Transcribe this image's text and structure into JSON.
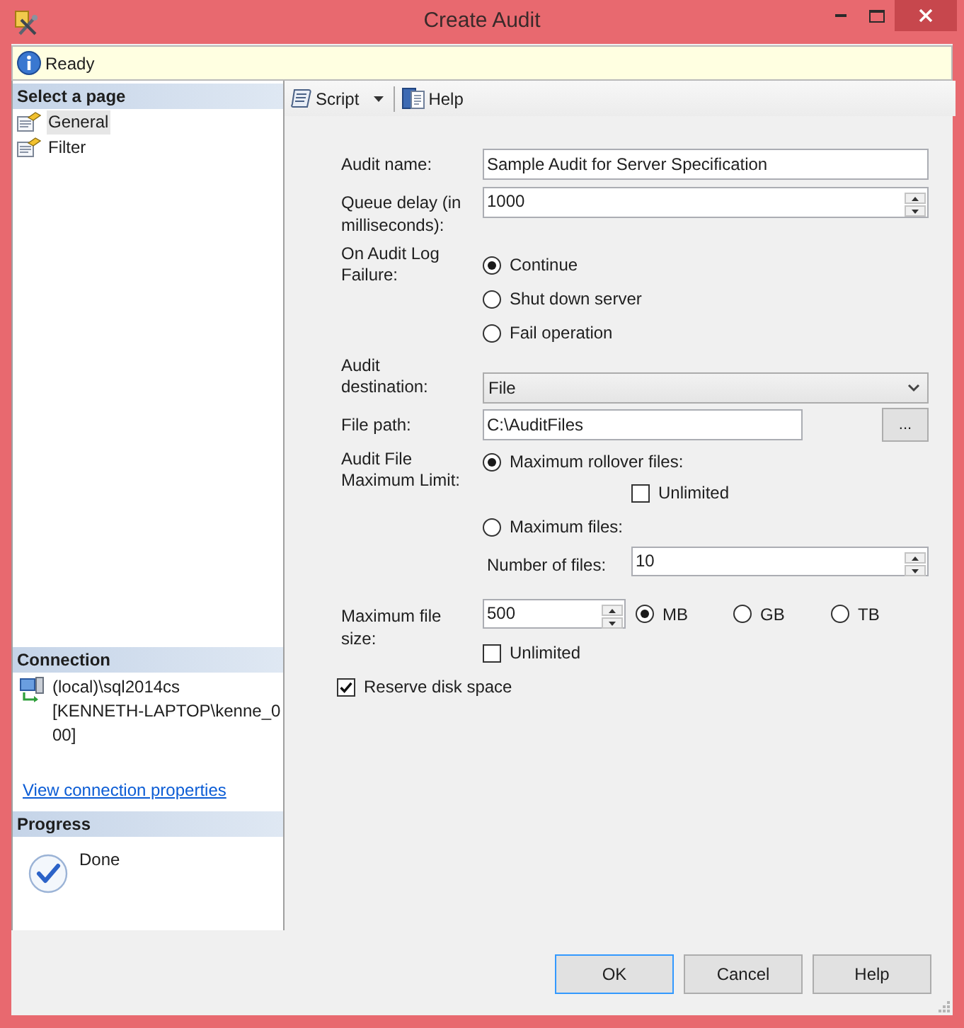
{
  "window": {
    "title": "Create Audit"
  },
  "status_bar": {
    "text": "Ready"
  },
  "sidebar": {
    "header": "Select a page",
    "items": [
      {
        "label": "General",
        "selected": true
      },
      {
        "label": "Filter",
        "selected": false
      }
    ]
  },
  "connection": {
    "header": "Connection",
    "server": "(local)\\sql2014cs",
    "login": "[KENNETH-LAPTOP\\kenne_000]",
    "link": "View connection properties"
  },
  "progress": {
    "header": "Progress",
    "status": "Done"
  },
  "toolbar": [
    {
      "kind": "dropdown",
      "label": "Script"
    },
    {
      "kind": "button",
      "label": "Help"
    }
  ],
  "form": {
    "audit_name": {
      "label": "Audit name:",
      "value": "Sample Audit for Server Specification"
    },
    "queue_delay": {
      "label": "Queue delay (in milliseconds):",
      "value": "1000"
    },
    "on_failure": {
      "label": "On Audit Log Failure:",
      "options": [
        {
          "label": "Continue",
          "selected": true
        },
        {
          "label": "Shut down server",
          "selected": false
        },
        {
          "label": "Fail operation",
          "selected": false
        }
      ]
    },
    "destination": {
      "label": "Audit destination:",
      "value": "File"
    },
    "file_path": {
      "label": "File path:",
      "value": "C:\\AuditFiles",
      "browse": "..."
    },
    "max_limit": {
      "label": "Audit File Maximum Limit:",
      "options": [
        {
          "label": "Maximum rollover files:",
          "selected": true
        },
        {
          "label": "Maximum files:",
          "selected": false
        }
      ],
      "unlimited": {
        "label": "Unlimited",
        "checked": false
      },
      "number_of_files": {
        "label": "Number of files:",
        "value": "10"
      }
    },
    "max_file_size": {
      "label": "Maximum file size:",
      "value": "500",
      "units": [
        {
          "label": "MB",
          "selected": true
        },
        {
          "label": "GB",
          "selected": false
        },
        {
          "label": "TB",
          "selected": false
        }
      ],
      "unlimited": {
        "label": "Unlimited",
        "checked": false
      }
    },
    "reserve_disk_space": {
      "label": "Reserve disk space",
      "checked": true
    }
  },
  "buttons": [
    {
      "label": "OK",
      "default": true
    },
    {
      "label": "Cancel",
      "default": false
    },
    {
      "label": "Help",
      "default": false
    }
  ]
}
